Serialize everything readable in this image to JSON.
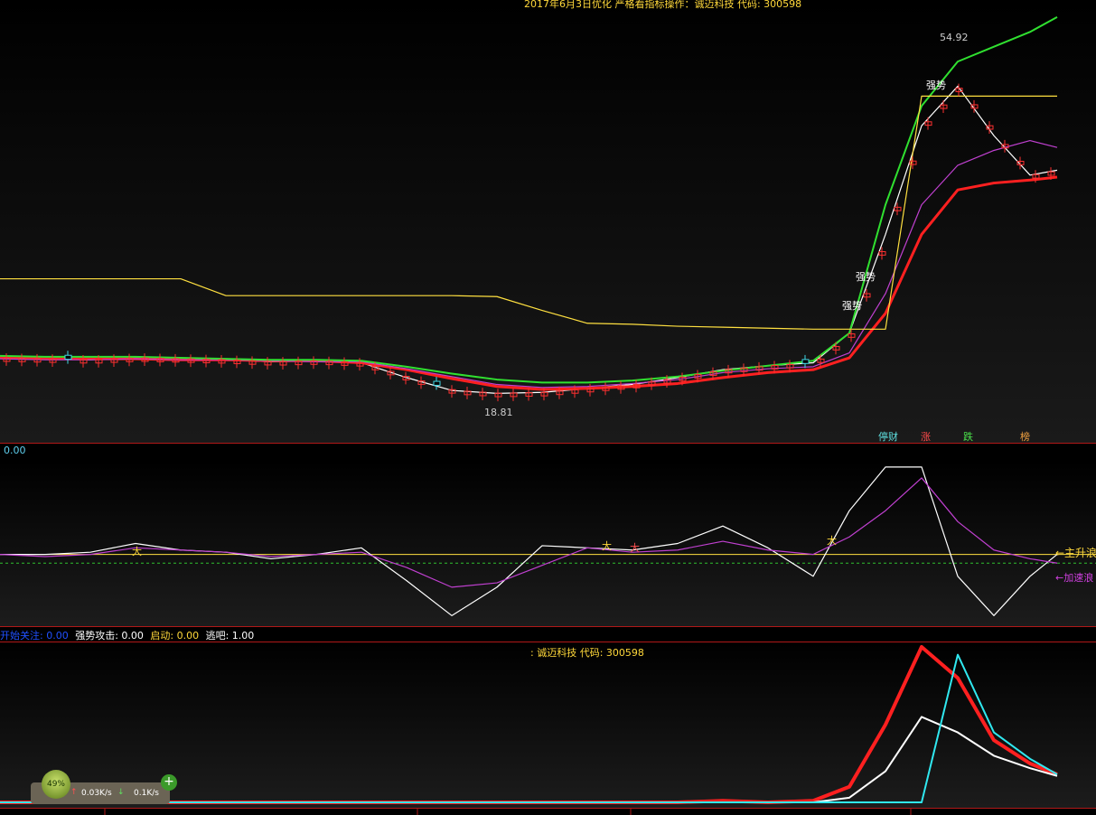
{
  "main": {
    "title": "2017年6月3日优化 严格看指标操作：诚迈科技 代码: 300598",
    "value_label": "0.00",
    "high_label": "54.92",
    "low_label": "18.81",
    "signals": [
      "强势",
      "强势",
      "强势"
    ],
    "buttons": {
      "b1": "停财",
      "b2": "涨",
      "b3": "跌",
      "b4": "榜"
    }
  },
  "osc": {
    "legend": {
      "l1": "开始关注: 0.00",
      "l2": "强势攻击: 0.00",
      "l3": "启动: 0.00",
      "l4": "逃吧: 1.00"
    },
    "right_labels": {
      "r1": "←主升浪",
      "r2": "←加速浪"
    },
    "markers": [
      "大",
      "大",
      "大",
      "大"
    ]
  },
  "bottom": {
    "title": ": 诚迈科技 代码: 300598"
  },
  "widget": {
    "cpu": "49%",
    "up": "0.03K/s",
    "down": "0.1K/s"
  },
  "chart_data": [
    {
      "type": "line",
      "title": "2017年6月3日优化 严格看指标操作：诚迈科技 代码: 300598",
      "x": [
        0,
        50,
        100,
        150,
        200,
        250,
        300,
        350,
        400,
        450,
        500,
        550,
        600,
        650,
        700,
        750,
        800,
        850,
        900,
        940,
        980,
        1020,
        1060,
        1100,
        1140,
        1170
      ],
      "series": [
        {
          "color": "#ffffff",
          "values": [
            22.5,
            22.4,
            22.3,
            22.5,
            22.4,
            22.3,
            22.1,
            22.2,
            22.0,
            20.5,
            19.2,
            18.9,
            19.0,
            19.4,
            19.8,
            20.5,
            21.3,
            21.7,
            22.0,
            25.0,
            35.0,
            46.0,
            50.0,
            45.0,
            41.0,
            41.5
          ]
        },
        {
          "color": "#ff2020",
          "values": [
            22.5,
            22.4,
            22.4,
            22.4,
            22.3,
            22.3,
            22.2,
            22.2,
            22.0,
            21.3,
            20.4,
            19.6,
            19.3,
            19.4,
            19.6,
            19.9,
            20.5,
            21.0,
            21.3,
            22.5,
            27.0,
            35.0,
            39.5,
            40.2,
            40.5,
            40.8
          ]
        },
        {
          "color": "#c040d0",
          "values": [
            22.4,
            22.3,
            22.3,
            22.4,
            22.3,
            22.3,
            22.2,
            22.1,
            22.1,
            21.4,
            20.6,
            19.8,
            19.5,
            19.6,
            19.9,
            20.3,
            21.0,
            21.4,
            21.6,
            23.0,
            29.0,
            38.0,
            42.0,
            43.5,
            44.5,
            43.8
          ]
        },
        {
          "color": "#30e030",
          "values": [
            22.7,
            22.6,
            22.6,
            22.6,
            22.5,
            22.4,
            22.3,
            22.3,
            22.2,
            21.6,
            20.9,
            20.3,
            20.0,
            20.0,
            20.2,
            20.6,
            21.2,
            21.7,
            22.2,
            25.0,
            38.0,
            48.0,
            52.5,
            54.0,
            55.5,
            57.0
          ]
        },
        {
          "color": "#ffe040",
          "values": [
            30.5,
            30.5,
            30.5,
            30.5,
            30.5,
            28.8,
            28.8,
            28.8,
            28.8,
            28.8,
            28.8,
            28.7,
            27.3,
            26.0,
            25.9,
            25.7,
            25.6,
            25.5,
            25.4,
            25.4,
            25.4,
            49.0,
            49.0,
            49.0,
            49.0,
            49.0
          ]
        }
      ],
      "annotations": [
        "54.92",
        "18.81",
        "强势"
      ]
    },
    {
      "type": "line",
      "series": [
        {
          "color": "#ffffff",
          "values": [
            0.0,
            0.0,
            0.1,
            0.5,
            0.2,
            0.1,
            -0.2,
            0.0,
            0.3,
            -1.2,
            -2.8,
            -1.5,
            0.4,
            0.3,
            0.2,
            0.5,
            1.3,
            0.3,
            -1.0,
            2.0,
            4.0,
            4.0,
            -1.0,
            -2.8,
            -1.0,
            0.0
          ]
        },
        {
          "color": "#c040d0",
          "values": [
            0.0,
            -0.1,
            0.0,
            0.3,
            0.2,
            0.1,
            -0.1,
            0.0,
            0.1,
            -0.6,
            -1.5,
            -1.3,
            -0.5,
            0.3,
            0.1,
            0.2,
            0.6,
            0.2,
            0.0,
            0.8,
            2.0,
            3.5,
            1.5,
            0.2,
            -0.2,
            -0.4
          ]
        }
      ],
      "reference_lines": [
        {
          "color": "#ffe040",
          "value": 0.0
        },
        {
          "color": "#30c030",
          "value": -0.4
        }
      ]
    },
    {
      "type": "line",
      "title": ": 诚迈科技 代码: 300598",
      "series": [
        {
          "color": "#ff2020",
          "values": [
            0,
            0,
            0,
            0,
            0,
            0,
            0,
            0,
            0,
            0,
            0,
            0,
            0,
            0,
            0,
            0,
            1,
            0,
            1,
            10,
            50,
            100,
            80,
            40,
            25,
            18
          ]
        },
        {
          "color": "#ffffff",
          "values": [
            0,
            0,
            0,
            0,
            0,
            0,
            0,
            0,
            0,
            0,
            0,
            0,
            0,
            0,
            0,
            0,
            0,
            0,
            0,
            3,
            20,
            55,
            45,
            30,
            22,
            17
          ]
        },
        {
          "color": "#30e8f0",
          "values": [
            0,
            0,
            0,
            0,
            0,
            0,
            0,
            0,
            0,
            0,
            0,
            0,
            0,
            0,
            0,
            0,
            0,
            0,
            0,
            0,
            0,
            0,
            95,
            45,
            28,
            18
          ]
        }
      ]
    }
  ]
}
